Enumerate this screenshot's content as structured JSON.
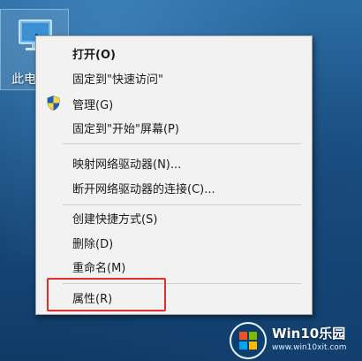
{
  "desktop": {
    "icon_label": "此电"
  },
  "context_menu": {
    "items": [
      {
        "label": "打开(O)"
      },
      {
        "label": "固定到\"快速访问\""
      },
      {
        "label": "管理(G)"
      },
      {
        "label": "固定到\"开始\"屏幕(P)"
      },
      {
        "label": "映射网络驱动器(N)..."
      },
      {
        "label": "断开网络驱动器的连接(C)..."
      },
      {
        "label": "创建快捷方式(S)"
      },
      {
        "label": "删除(D)"
      },
      {
        "label": "重命名(M)"
      },
      {
        "label": "属性(R)"
      }
    ]
  },
  "watermark": {
    "brand": "Win10乐园",
    "url": "www.win10xit.com"
  },
  "colors": {
    "highlight": "#e0302c",
    "menu_bg": "#f2f2f2",
    "desktop": "#1f5a86"
  }
}
